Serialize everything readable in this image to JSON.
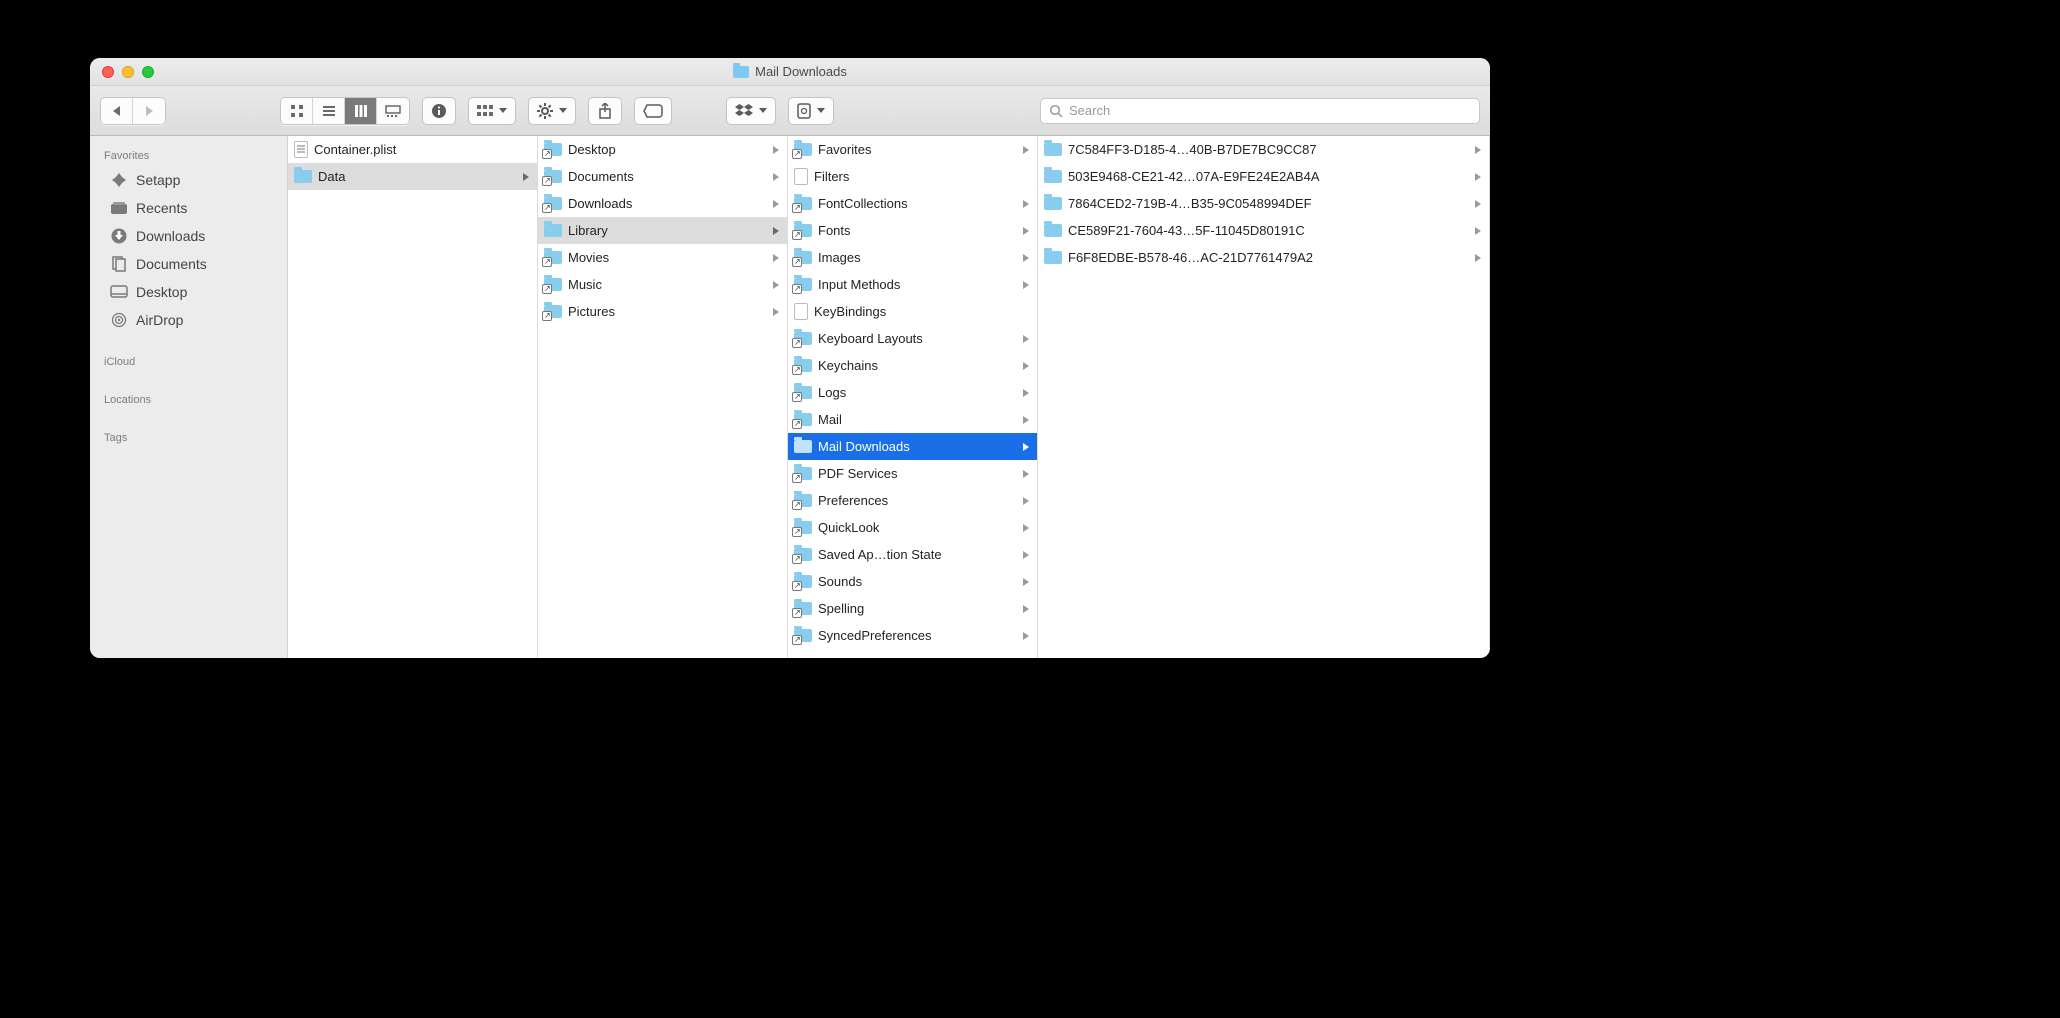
{
  "window": {
    "title": "Mail Downloads"
  },
  "toolbar": {
    "search_placeholder": "Search"
  },
  "sidebar": {
    "sections": {
      "favorites": "Favorites",
      "icloud": "iCloud",
      "locations": "Locations",
      "tags": "Tags"
    },
    "favorites": [
      {
        "label": "Setapp",
        "icon": "setapp"
      },
      {
        "label": "Recents",
        "icon": "recents"
      },
      {
        "label": "Downloads",
        "icon": "downloads"
      },
      {
        "label": "Documents",
        "icon": "documents"
      },
      {
        "label": "Desktop",
        "icon": "desktop"
      },
      {
        "label": "AirDrop",
        "icon": "airdrop"
      }
    ]
  },
  "columns": [
    {
      "items": [
        {
          "label": "Container.plist",
          "type": "plist",
          "arrow": false
        },
        {
          "label": "Data",
          "type": "folder",
          "arrow": true,
          "selected": "gray"
        }
      ]
    },
    {
      "items": [
        {
          "label": "Desktop",
          "type": "folder-alias",
          "arrow": true
        },
        {
          "label": "Documents",
          "type": "folder-alias",
          "arrow": true
        },
        {
          "label": "Downloads",
          "type": "folder-alias",
          "arrow": true
        },
        {
          "label": "Library",
          "type": "folder",
          "arrow": true,
          "selected": "gray"
        },
        {
          "label": "Movies",
          "type": "folder-alias",
          "arrow": true
        },
        {
          "label": "Music",
          "type": "folder-alias",
          "arrow": true
        },
        {
          "label": "Pictures",
          "type": "folder-alias",
          "arrow": true
        }
      ]
    },
    {
      "items": [
        {
          "label": "Favorites",
          "type": "folder-alias",
          "arrow": true
        },
        {
          "label": "Filters",
          "type": "file",
          "arrow": false
        },
        {
          "label": "FontCollections",
          "type": "folder-alias",
          "arrow": true
        },
        {
          "label": "Fonts",
          "type": "folder-alias",
          "arrow": true
        },
        {
          "label": "Images",
          "type": "folder-alias",
          "arrow": true
        },
        {
          "label": "Input Methods",
          "type": "folder-alias",
          "arrow": true
        },
        {
          "label": "KeyBindings",
          "type": "file",
          "arrow": false
        },
        {
          "label": "Keyboard Layouts",
          "type": "folder-alias",
          "arrow": true
        },
        {
          "label": "Keychains",
          "type": "folder-alias",
          "arrow": true
        },
        {
          "label": "Logs",
          "type": "folder-alias",
          "arrow": true
        },
        {
          "label": "Mail",
          "type": "folder-alias",
          "arrow": true
        },
        {
          "label": "Mail Downloads",
          "type": "folder",
          "arrow": true,
          "selected": "blue"
        },
        {
          "label": "PDF Services",
          "type": "folder-alias",
          "arrow": true
        },
        {
          "label": "Preferences",
          "type": "folder-alias",
          "arrow": true
        },
        {
          "label": "QuickLook",
          "type": "folder-alias",
          "arrow": true
        },
        {
          "label": "Saved Ap…tion State",
          "type": "folder-alias",
          "arrow": true
        },
        {
          "label": "Sounds",
          "type": "folder-alias",
          "arrow": true
        },
        {
          "label": "Spelling",
          "type": "folder-alias",
          "arrow": true
        },
        {
          "label": "SyncedPreferences",
          "type": "folder-alias",
          "arrow": true
        }
      ]
    },
    {
      "items": [
        {
          "label": "7C584FF3-D185-4…40B-B7DE7BC9CC87",
          "type": "folder",
          "arrow": true
        },
        {
          "label": "503E9468-CE21-42…07A-E9FE24E2AB4A",
          "type": "folder",
          "arrow": true
        },
        {
          "label": "7864CED2-719B-4…B35-9C0548994DEF",
          "type": "folder",
          "arrow": true
        },
        {
          "label": "CE589F21-7604-43…5F-11045D80191C",
          "type": "folder",
          "arrow": true
        },
        {
          "label": "F6F8EDBE-B578-46…AC-21D7761479A2",
          "type": "folder",
          "arrow": true
        }
      ]
    }
  ]
}
